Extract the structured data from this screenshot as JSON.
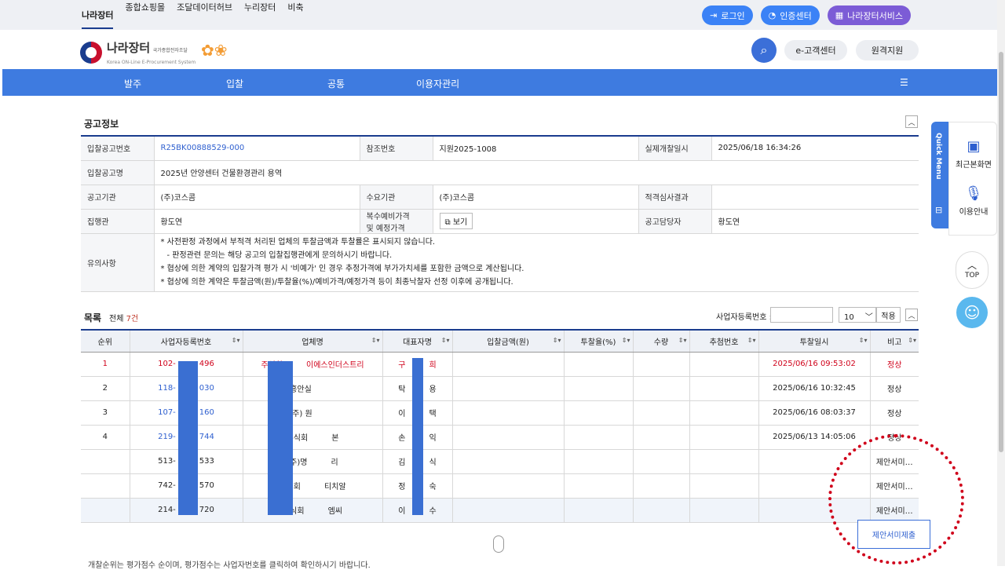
{
  "topnav": [
    "나라장터",
    "종합쇼핑몰",
    "조달데이터허브",
    "누리장터",
    "비축"
  ],
  "topbtns": {
    "login": "로그인",
    "cert": "인증센터",
    "service": "나라장터서비스"
  },
  "logo": {
    "name": "나라장터",
    "sub1": "국가종합전자조달",
    "sub2": "Korea ON-Line E-Procurement System"
  },
  "header": {
    "cs": "e-고객센터",
    "remote": "원격지원"
  },
  "mainnav": [
    "발주",
    "입찰",
    "공통",
    "이용자관리"
  ],
  "section_title": "공고정보",
  "info": {
    "bid_no_label": "입찰공고번호",
    "bid_no": "R25BK00888529-000",
    "ref_label": "참조번호",
    "ref": "지원2025-1008",
    "open_label": "실제개찰일시",
    "open": "2025/06/18 16:34:26",
    "name_label": "입찰공고명",
    "name": "2025년 안양센터 건물환경관리 용역",
    "org_label": "공고기관",
    "org": "(주)코스콤",
    "demand_label": "수요기관",
    "demand": "(주)코스콤",
    "review_label": "적격심사결과",
    "review": "",
    "exec_label": "집행관",
    "exec": "황도연",
    "price_label1": "복수예비가격",
    "price_label2": "및 예정가격",
    "view": "보기",
    "manager_label": "공고담당자",
    "manager": "황도연",
    "notes_label": "유의사항",
    "notes": [
      "* 사전판정 과정에서 부적격 처리된 업체의 투찰금액과 투찰률은 표시되지 않습니다.",
      "  - 판정관련 문의는 해당 공고의 입찰집행관에게 문의하시기 바랍니다.",
      "* 협상에 의한 계약의 입찰가격 평가 시 '비예가' 인 경우 추정가격에 부가가치세를 포함한 금액으로 계산됩니다.",
      "* 협상에 의한 계약은 투찰금액(원)/투찰율(%)/예비가격/예정가격 등이 최종낙찰자 선정 이후에 공개됩니다."
    ]
  },
  "list": {
    "title": "목록",
    "total_prefix": "전체 ",
    "total": "7건",
    "biz_label": "사업자등록번호 :",
    "page_size": "10",
    "apply": "적용",
    "headers": [
      "순위",
      "사업자등록번호",
      "업체명",
      "대표자명",
      "입찰금액(원)",
      "투찰율(%)",
      "수량",
      "추첨번호",
      "투찰일시",
      "비고"
    ],
    "rows": [
      [
        "1",
        "102-",
        "496",
        "주식회",
        "이에스인더스트리",
        "구",
        "희",
        "",
        "",
        "",
        "",
        "2025/06/16 09:53:02",
        "정상"
      ],
      [
        "2",
        "118-",
        "030",
        "흥안실",
        "",
        "탁",
        "용",
        "",
        "",
        "",
        "",
        "2025/06/16 10:32:45",
        "정상"
      ],
      [
        "3",
        "107-",
        "160",
        "(주) 원",
        "",
        "이",
        "택",
        "",
        "",
        "",
        "",
        "2025/06/16 08:03:37",
        "정상"
      ],
      [
        "4",
        "219-",
        "744",
        "주식회",
        "본",
        "손",
        "익",
        "",
        "",
        "",
        "",
        "2025/06/13 14:05:06",
        "정상"
      ],
      [
        "",
        "513-",
        "533",
        "(주)명",
        "리",
        "김",
        "식",
        "",
        "",
        "",
        "",
        "",
        "제안서미…"
      ],
      [
        "",
        "742-",
        "570",
        "주식회",
        "티치알",
        "정",
        "숙",
        "",
        "",
        "",
        "",
        "",
        "제안서미…"
      ],
      [
        "",
        "214-",
        "720",
        "주식회",
        "엠씨",
        "이",
        "수",
        "",
        "",
        "",
        "",
        "",
        "제안서미…"
      ]
    ]
  },
  "propose_btn": "제안서미제출",
  "quick": {
    "title": "Quick Menu",
    "recent": "최근본화면",
    "guide": "이용안내",
    "top": "TOP"
  },
  "bottom": "개찰순위는 평가점수 순이며, 평가점수는 사업자번호를 클릭하여 확인하시기 바랍니다."
}
